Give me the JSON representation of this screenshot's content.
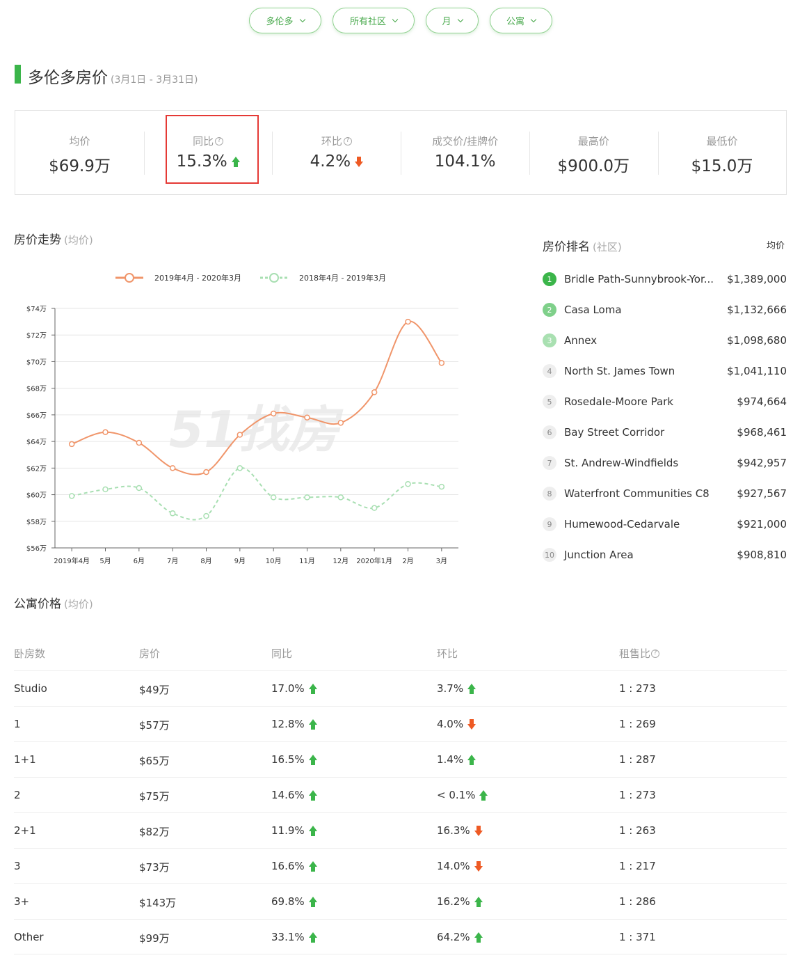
{
  "filters": [
    {
      "label": "多伦多"
    },
    {
      "label": "所有社区"
    },
    {
      "label": "月"
    },
    {
      "label": "公寓"
    }
  ],
  "header": {
    "title": "多伦多房价",
    "date_range": "(3月1日 - 3月31日)"
  },
  "stats": [
    {
      "label": "均价",
      "value": "$69.9万",
      "help": false,
      "trend": null
    },
    {
      "label": "同比",
      "value": "15.3%",
      "help": true,
      "trend": "up"
    },
    {
      "label": "环比",
      "value": "4.2%",
      "help": true,
      "trend": "down"
    },
    {
      "label": "成交价/挂牌价",
      "value": "104.1%",
      "help": false,
      "trend": null
    },
    {
      "label": "最高价",
      "value": "$900.0万",
      "help": false,
      "trend": null
    },
    {
      "label": "最低价",
      "value": "$15.0万",
      "help": false,
      "trend": null
    }
  ],
  "trend_section": {
    "title": "房价走势",
    "subtitle": "(均价)"
  },
  "chart_data": {
    "type": "line",
    "categories": [
      "2019年4月",
      "5月",
      "6月",
      "7月",
      "8月",
      "9月",
      "10月",
      "11月",
      "12月",
      "2020年1月",
      "2月",
      "3月"
    ],
    "series": [
      {
        "name": "2019年4月 - 2020年3月",
        "color": "#f0956a",
        "style": "solid",
        "values": [
          63.8,
          64.7,
          63.9,
          62.0,
          61.7,
          64.5,
          66.1,
          65.8,
          65.4,
          67.7,
          73.0,
          69.9
        ]
      },
      {
        "name": "2018年4月 - 2019年3月",
        "color": "#a8dfb2",
        "style": "dashed",
        "values": [
          59.9,
          60.4,
          60.5,
          58.6,
          58.4,
          62.0,
          59.8,
          59.8,
          59.8,
          59.0,
          60.8,
          60.6
        ]
      }
    ],
    "ylim": [
      56,
      74
    ],
    "yticks": [
      "$56万",
      "$58万",
      "$60万",
      "$62万",
      "$64万",
      "$66万",
      "$68万",
      "$70万",
      "$72万",
      "$74万"
    ],
    "grid": true,
    "legend": "top-center"
  },
  "ranking": {
    "title": "房价排名",
    "subtitle": "(社区)",
    "column_label": "均价",
    "items": [
      {
        "rank": "1",
        "name": "Bridle Path-Sunnybrook-Yor...",
        "price": "$1,389,000",
        "color": "#3bb54a"
      },
      {
        "rank": "2",
        "name": "Casa Loma",
        "price": "$1,132,666",
        "color": "#7fd08a"
      },
      {
        "rank": "3",
        "name": "Annex",
        "price": "$1,098,680",
        "color": "#a9e0b1"
      },
      {
        "rank": "4",
        "name": "North St. James Town",
        "price": "$1,041,110",
        "color": "#eeeeee"
      },
      {
        "rank": "5",
        "name": "Rosedale-Moore Park",
        "price": "$974,664",
        "color": "#eeeeee"
      },
      {
        "rank": "6",
        "name": "Bay Street Corridor",
        "price": "$968,461",
        "color": "#eeeeee"
      },
      {
        "rank": "7",
        "name": "St. Andrew-Windfields",
        "price": "$942,957",
        "color": "#eeeeee"
      },
      {
        "rank": "8",
        "name": "Waterfront Communities C8",
        "price": "$927,567",
        "color": "#eeeeee"
      },
      {
        "rank": "9",
        "name": "Humewood-Cedarvale",
        "price": "$921,000",
        "color": "#eeeeee"
      },
      {
        "rank": "10",
        "name": "Junction Area",
        "price": "$908,810",
        "color": "#eeeeee"
      }
    ]
  },
  "condo_section": {
    "title": "公寓价格",
    "subtitle": "(均价)"
  },
  "table": {
    "headers": [
      "卧房数",
      "房价",
      "同比",
      "环比",
      "租售比"
    ],
    "rows": [
      {
        "beds": "Studio",
        "price": "$49万",
        "yoy": "17.0%",
        "yoy_trend": "up",
        "mom": "3.7%",
        "mom_trend": "up",
        "ratio": "1 : 273"
      },
      {
        "beds": "1",
        "price": "$57万",
        "yoy": "12.8%",
        "yoy_trend": "up",
        "mom": "4.0%",
        "mom_trend": "down",
        "ratio": "1 : 269"
      },
      {
        "beds": "1+1",
        "price": "$65万",
        "yoy": "16.5%",
        "yoy_trend": "up",
        "mom": "1.4%",
        "mom_trend": "up",
        "ratio": "1 : 287"
      },
      {
        "beds": "2",
        "price": "$75万",
        "yoy": "14.6%",
        "yoy_trend": "up",
        "mom": "< 0.1%",
        "mom_trend": "up",
        "ratio": "1 : 273"
      },
      {
        "beds": "2+1",
        "price": "$82万",
        "yoy": "11.9%",
        "yoy_trend": "up",
        "mom": "16.3%",
        "mom_trend": "down",
        "ratio": "1 : 263"
      },
      {
        "beds": "3",
        "price": "$73万",
        "yoy": "16.6%",
        "yoy_trend": "up",
        "mom": "14.0%",
        "mom_trend": "down",
        "ratio": "1 : 217"
      },
      {
        "beds": "3+",
        "price": "$143万",
        "yoy": "69.8%",
        "yoy_trend": "up",
        "mom": "16.2%",
        "mom_trend": "up",
        "ratio": "1 : 286"
      },
      {
        "beds": "Other",
        "price": "$99万",
        "yoy": "33.1%",
        "yoy_trend": "up",
        "mom": "64.2%",
        "mom_trend": "up",
        "ratio": "1 : 371"
      }
    ]
  },
  "icons": {
    "up": "arrow-up-icon",
    "down": "arrow-down-icon",
    "help": "question-circle-icon",
    "dropdown": "chevron-down-icon"
  }
}
